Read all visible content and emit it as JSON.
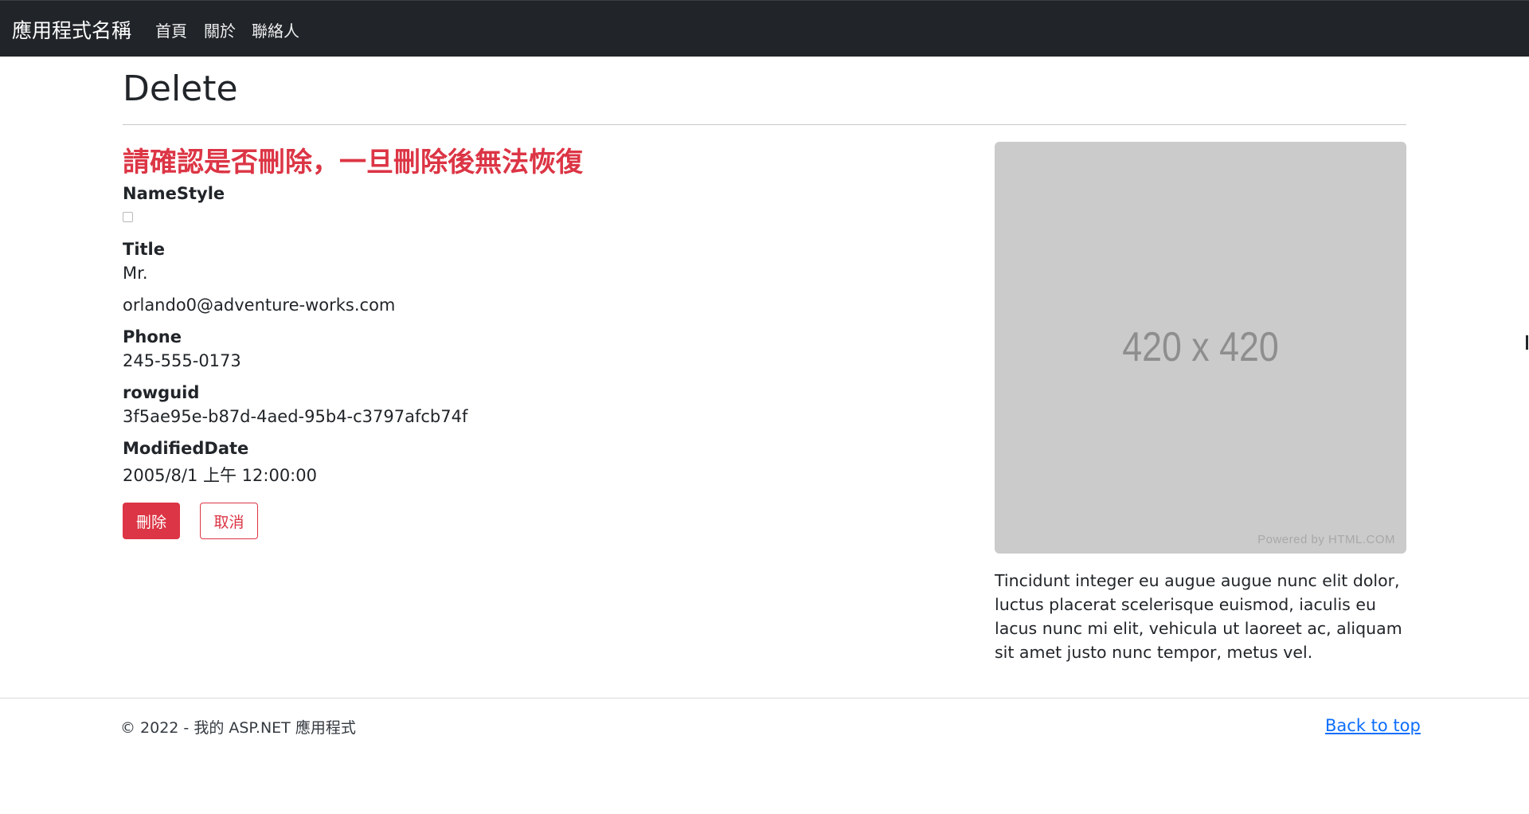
{
  "navbar": {
    "brand": "應用程式名稱",
    "links": {
      "home": "首頁",
      "about": "關於",
      "contact": "聯絡人"
    }
  },
  "page": {
    "title": "Delete",
    "warning": "請確認是否刪除，一旦刪除後無法恢復"
  },
  "fields": {
    "namestyle_label": "NameStyle",
    "namestyle_checked": false,
    "title_label": "Title",
    "title_value": "Mr.",
    "email_value": "orlando0@adventure-works.com",
    "phone_label": "Phone",
    "phone_value": "245-555-0173",
    "rowguid_label": "rowguid",
    "rowguid_value": "3f5ae95e-b87d-4aed-95b4-c3797afcb74f",
    "modified_label": "ModifiedDate",
    "modified_value": "2005/8/1 上午 12:00:00"
  },
  "actions": {
    "delete_label": "刪除",
    "cancel_label": "取消"
  },
  "sidebar": {
    "image_size_text": "420 x 420",
    "image_powered_text": "Powered by HTML.COM",
    "text": "Tincidunt integer eu augue augue nunc elit dolor, luctus placerat scelerisque euismod, iaculis eu lacus nunc mi elit, vehicula ut laoreet ac, aliquam sit amet justo nunc tempor, metus vel."
  },
  "footer": {
    "copyright": "© 2022 - 我的 ASP.NET 應用程式",
    "back_to_top": "Back to top"
  },
  "colors": {
    "navbar_bg": "#212529",
    "danger": "#dc3545",
    "link": "#0d6efd",
    "placeholder_bg": "#cbcbcb"
  }
}
